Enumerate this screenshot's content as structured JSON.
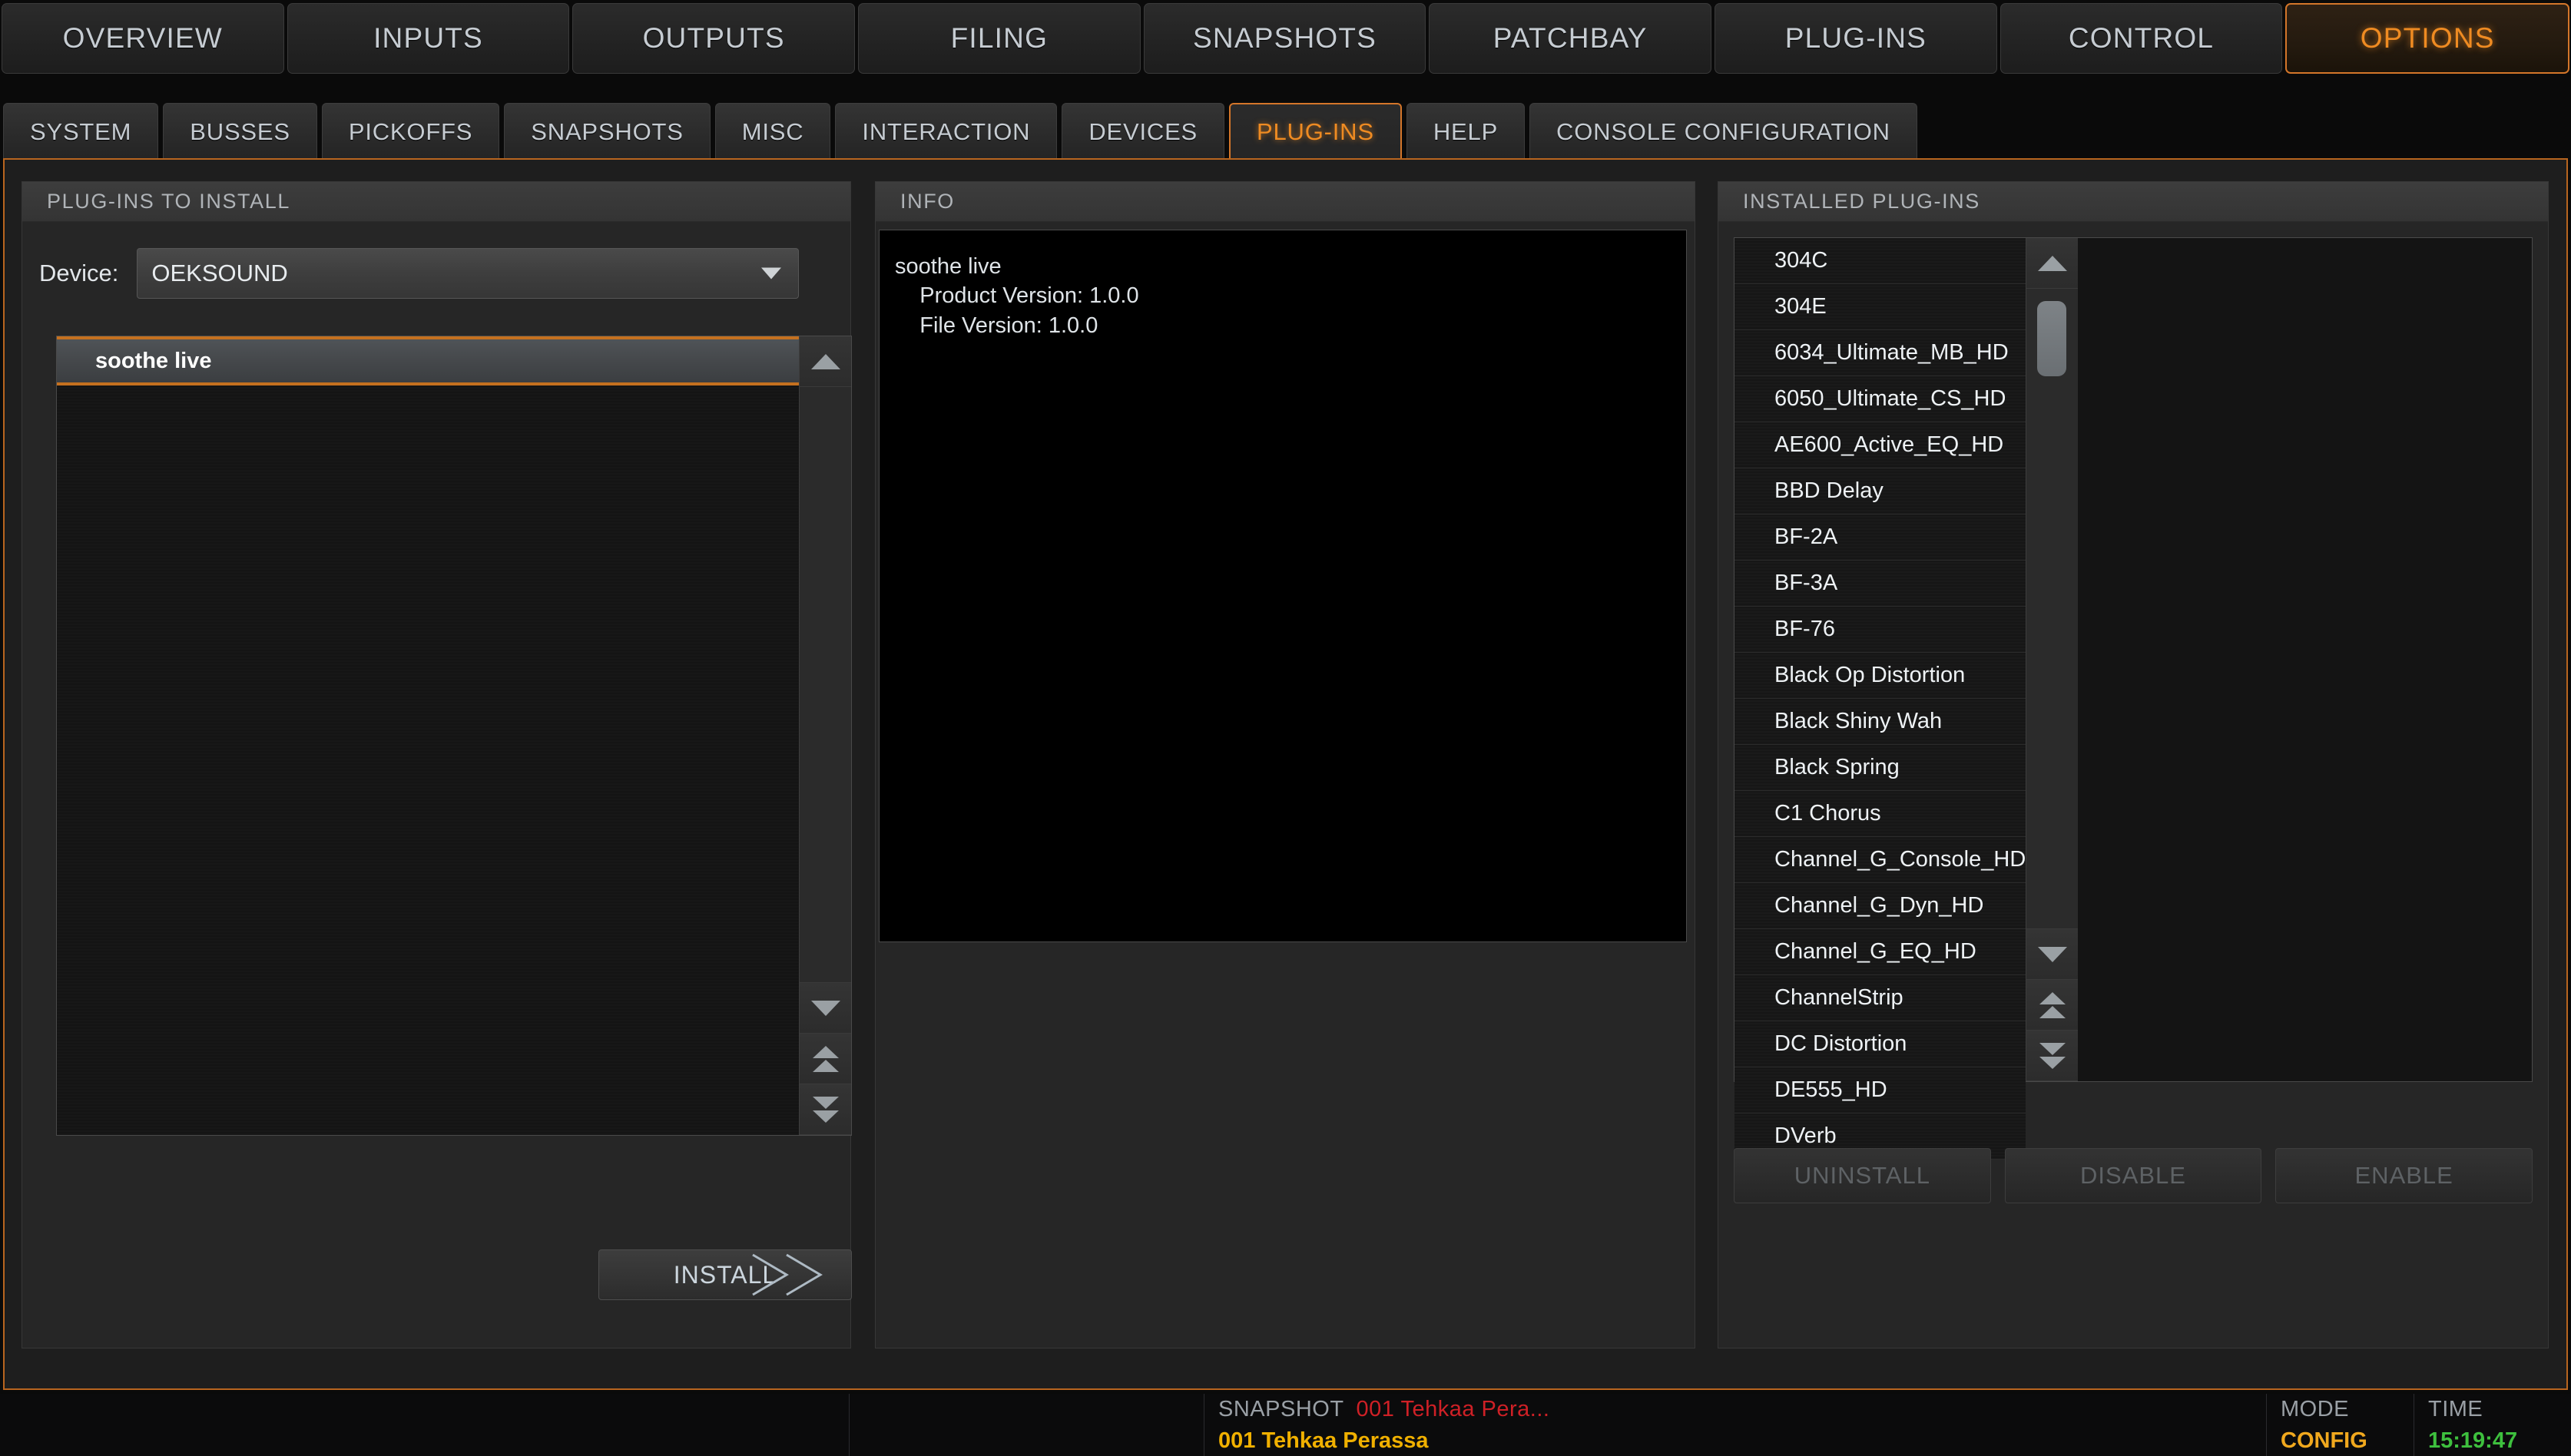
{
  "top_tabs": [
    {
      "label": "OVERVIEW",
      "active": false
    },
    {
      "label": "INPUTS",
      "active": false
    },
    {
      "label": "OUTPUTS",
      "active": false
    },
    {
      "label": "FILING",
      "active": false
    },
    {
      "label": "SNAPSHOTS",
      "active": false
    },
    {
      "label": "PATCHBAY",
      "active": false
    },
    {
      "label": "PLUG-INS",
      "active": false
    },
    {
      "label": "CONTROL",
      "active": false
    },
    {
      "label": "OPTIONS",
      "active": true
    }
  ],
  "sub_tabs": [
    {
      "label": "SYSTEM",
      "active": false
    },
    {
      "label": "BUSSES",
      "active": false
    },
    {
      "label": "PICKOFFS",
      "active": false
    },
    {
      "label": "SNAPSHOTS",
      "active": false
    },
    {
      "label": "MISC",
      "active": false
    },
    {
      "label": "INTERACTION",
      "active": false
    },
    {
      "label": "DEVICES",
      "active": false
    },
    {
      "label": "PLUG-INS",
      "active": true
    },
    {
      "label": "HELP",
      "active": false
    },
    {
      "label": "CONSOLE CONFIGURATION",
      "active": false
    }
  ],
  "left_panel": {
    "title": "PLUG-INS TO INSTALL",
    "device_label": "Device:",
    "device_value": "OEKSOUND",
    "items": [
      {
        "label": "soothe live",
        "selected": true
      }
    ],
    "install_label": "INSTALL"
  },
  "info_panel": {
    "title": "INFO",
    "text": "soothe live\n    Product Version: 1.0.0\n    File Version: 1.0.0"
  },
  "right_panel": {
    "title": "INSTALLED PLUG-INS",
    "items": [
      "304C",
      "304E",
      "6034_Ultimate_MB_HD",
      "6050_Ultimate_CS_HD",
      "AE600_Active_EQ_HD",
      "BBD Delay",
      "BF-2A",
      "BF-3A",
      "BF-76",
      "Black Op Distortion",
      "Black Shiny Wah",
      "Black Spring",
      "C1 Chorus",
      "Channel_G_Console_HD",
      "Channel_G_Dyn_HD",
      "Channel_G_EQ_HD",
      "ChannelStrip",
      "DC Distortion",
      "DE555_HD",
      "DVerb"
    ],
    "buttons": [
      {
        "label": "UNINSTALL",
        "enabled": false
      },
      {
        "label": "DISABLE",
        "enabled": false
      },
      {
        "label": "ENABLE",
        "enabled": false
      }
    ]
  },
  "status_bar": {
    "snapshot_label": "SNAPSHOT",
    "snapshot_current": "001 Tehkaa Pera...",
    "snapshot_next": "001 Tehkaa Perassa",
    "mode_label": "MODE",
    "mode_value": "CONFIG",
    "time_label": "TIME",
    "time_value": "15:19:47"
  },
  "colors": {
    "accent_orange": "#ef8b22",
    "border_orange": "#b8651f",
    "status_red": "#cf2026",
    "status_gold": "#f0b000",
    "status_green": "#3ec03e"
  }
}
